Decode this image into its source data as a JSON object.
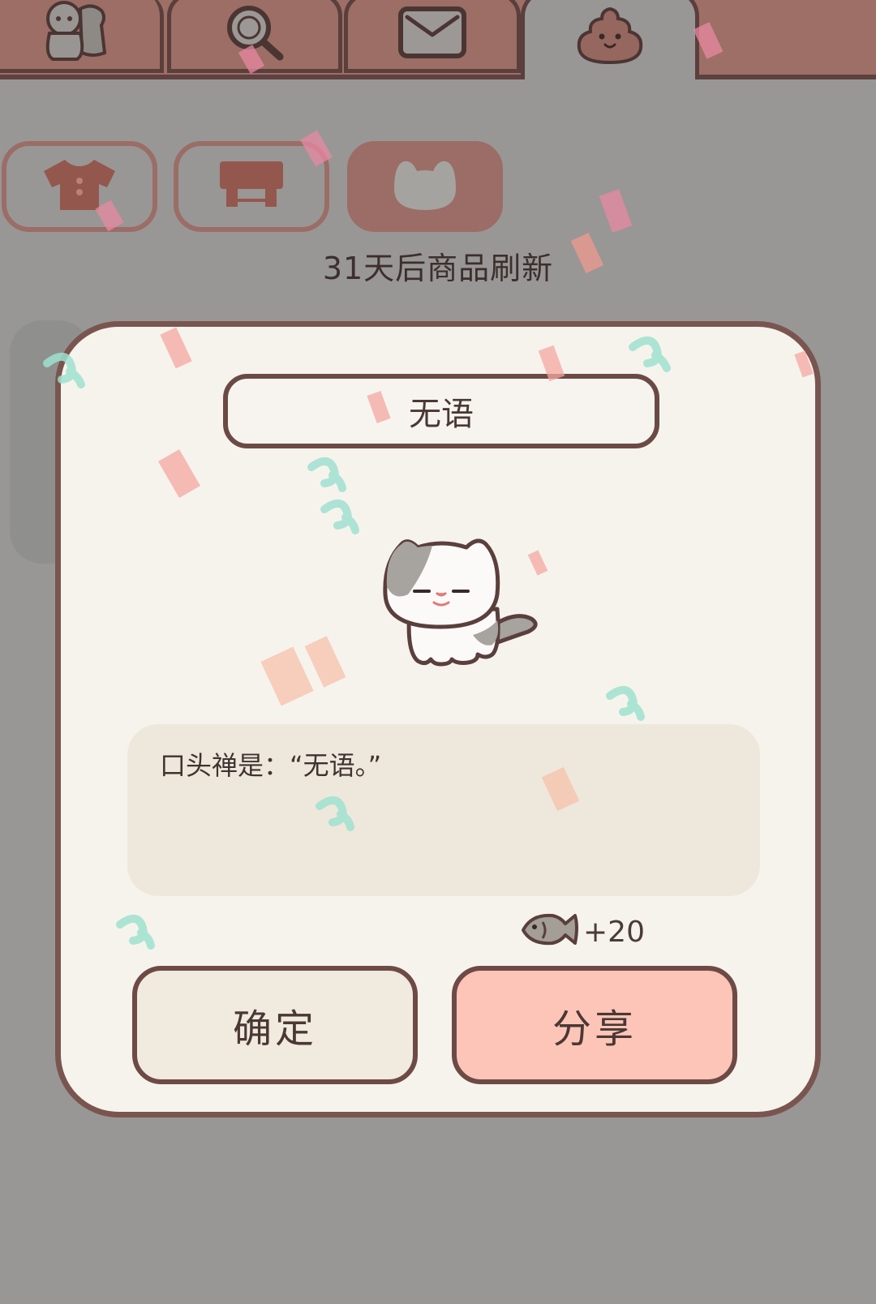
{
  "tabs": [
    {
      "name": "friends",
      "icon": "people-icon"
    },
    {
      "name": "search",
      "icon": "magnifier-icon"
    },
    {
      "name": "mail",
      "icon": "envelope-icon"
    },
    {
      "name": "shop",
      "icon": "poop-icon",
      "active": true
    }
  ],
  "categories": [
    {
      "name": "clothes",
      "icon": "shirt-icon"
    },
    {
      "name": "furniture",
      "icon": "table-icon"
    },
    {
      "name": "cats",
      "icon": "cat-face-icon",
      "active": true
    }
  ],
  "refresh_notice": "31天后商品刷新",
  "dialog": {
    "name": "无语",
    "catchphrase": "口头禅是：“无语。”",
    "reward": "+20",
    "reward_icon": "fish-icon",
    "confirm_label": "确定",
    "share_label": "分享"
  },
  "colors": {
    "accent_brown": "#9b6d66",
    "outline_dark": "#6e4a45",
    "share_pink": "#fcc5b7",
    "dialog_bg": "#f6f3ed",
    "overlay_grey": "#989795"
  }
}
